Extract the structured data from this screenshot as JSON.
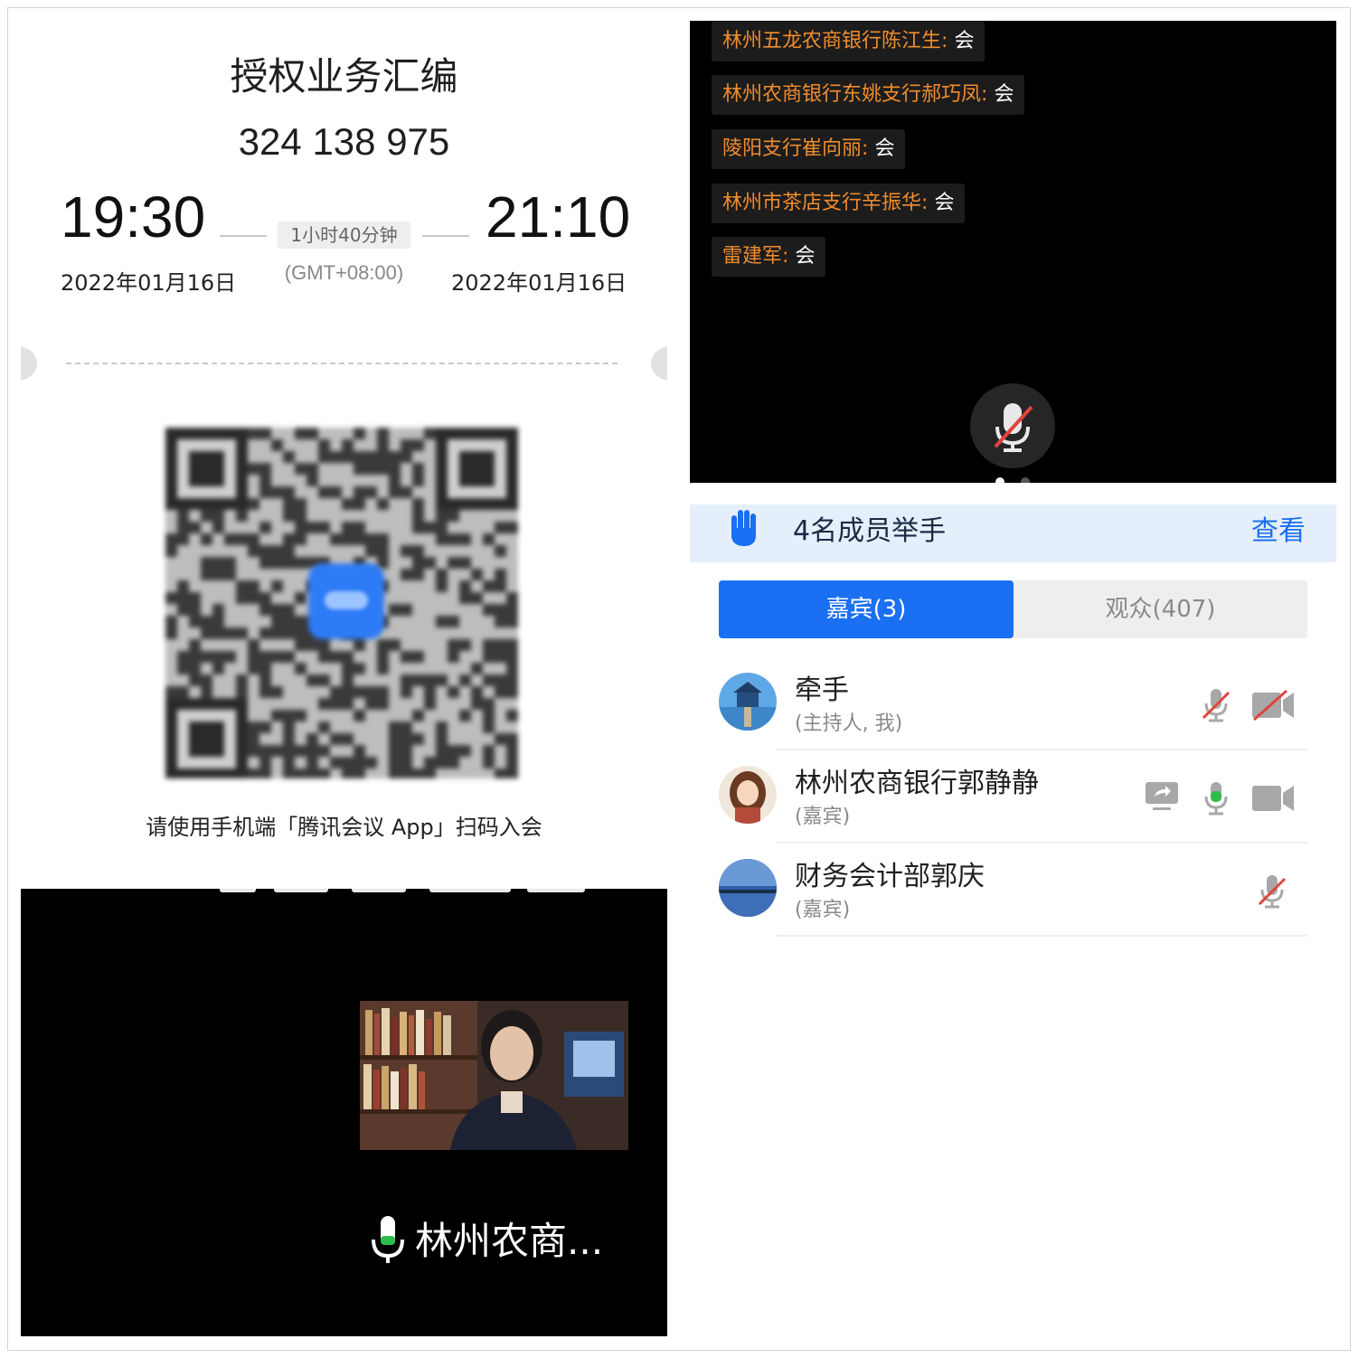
{
  "ticket": {
    "title": "授权业务汇编",
    "meeting_id": "324 138 975",
    "start_time": "19:30",
    "end_time": "21:10",
    "duration": "1小时40分钟",
    "start_date": "2022年01月16日",
    "end_date": "2022年01月16日",
    "timezone": "(GMT+08:00)",
    "scan_hint": "请使用手机端「腾讯会议 App」扫码入会"
  },
  "chat": {
    "messages": [
      {
        "sender": "林州五龙农商银行陈江生",
        "text": "会"
      },
      {
        "sender": "林州农商银行东姚支行郝巧凤",
        "text": "会"
      },
      {
        "sender": "陵阳支行崔向丽",
        "text": "会"
      },
      {
        "sender": "林州市茶店支行辛振华",
        "text": "会"
      },
      {
        "sender": "雷建军",
        "text": "会"
      }
    ],
    "separator": ":"
  },
  "participants": {
    "raise_hand_text": "4名成员举手",
    "view_label": "查看",
    "tabs": [
      {
        "label": "嘉宾(3)",
        "active": true
      },
      {
        "label": "观众(407)",
        "active": false
      }
    ],
    "list": [
      {
        "name": "牵手",
        "role": "(主持人, 我)",
        "mic": "muted",
        "camera": "off",
        "screen_share": false
      },
      {
        "name": "林州农商银行郭静静",
        "role": "(嘉宾)",
        "mic": "active",
        "camera": "on",
        "screen_share": true
      },
      {
        "name": "财务会计部郭庆",
        "role": "(嘉宾)",
        "mic": "muted",
        "camera": "none",
        "screen_share": false
      }
    ],
    "colors": {
      "accent": "#1a6ff2",
      "mic_active": "#2ebd4a",
      "muted": "#e0443c"
    }
  },
  "video": {
    "speaker_label": "林州农商..."
  }
}
